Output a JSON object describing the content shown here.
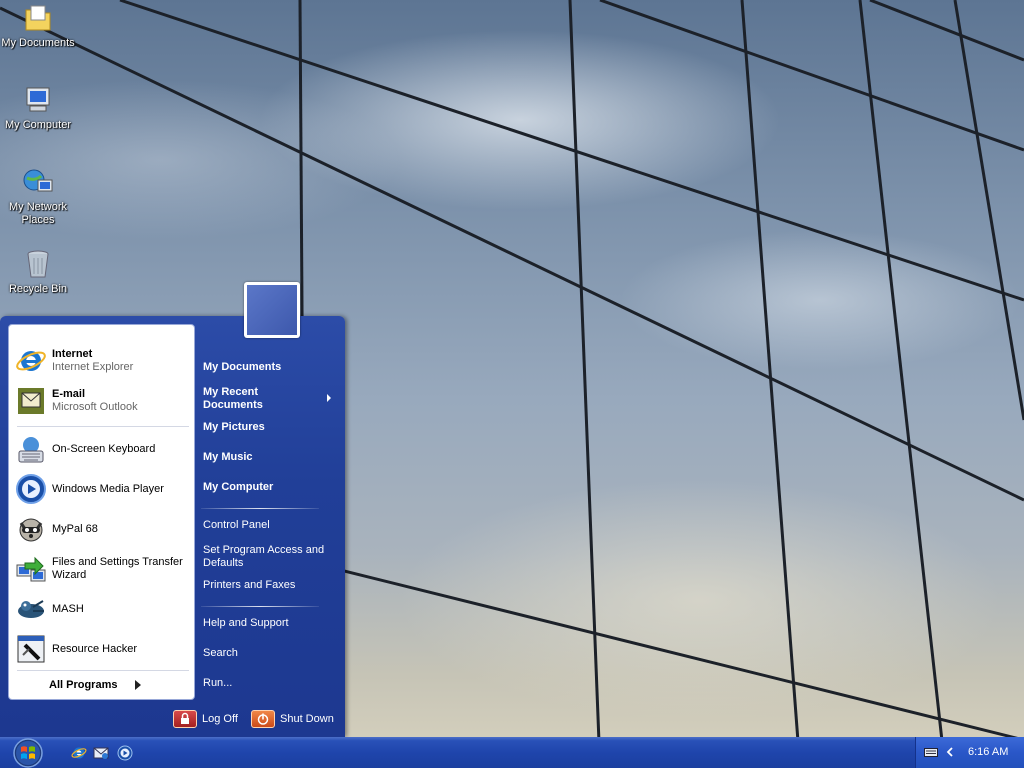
{
  "desktop": {
    "icons": [
      {
        "label": "My Documents",
        "icon": "folder-icon"
      },
      {
        "label": "My Computer",
        "icon": "computer-icon"
      },
      {
        "label": "My Network Places",
        "icon": "network-icon"
      },
      {
        "label": "Recycle Bin",
        "icon": "recycle-bin-icon"
      }
    ]
  },
  "start_menu": {
    "pinned": [
      {
        "title": "Internet",
        "subtitle": "Internet Explorer",
        "icon": "internet-explorer-icon"
      },
      {
        "title": "E-mail",
        "subtitle": "Microsoft Outlook",
        "icon": "outlook-icon"
      }
    ],
    "recent": [
      {
        "label": "On-Screen Keyboard",
        "icon": "keyboard-icon"
      },
      {
        "label": "Windows Media Player",
        "icon": "media-player-icon"
      },
      {
        "label": "MyPal 68",
        "icon": "mypal-icon"
      },
      {
        "label": "Files and Settings Transfer Wizard",
        "icon": "transfer-wizard-icon"
      },
      {
        "label": "MASH",
        "icon": "mash-icon"
      },
      {
        "label": "Resource Hacker",
        "icon": "resource-hacker-icon"
      }
    ],
    "all_programs": "All Programs",
    "places": [
      {
        "label": "My Documents"
      },
      {
        "label": "My Recent Documents"
      },
      {
        "label": "My Pictures"
      },
      {
        "label": "My Music"
      },
      {
        "label": "My Computer"
      }
    ],
    "system": [
      {
        "label": "Control Panel"
      },
      {
        "label": "Set Program Access and Defaults"
      },
      {
        "label": "Printers and Faxes"
      }
    ],
    "help": [
      {
        "label": "Help and Support"
      },
      {
        "label": "Search"
      },
      {
        "label": "Run..."
      }
    ],
    "log_off": "Log Off",
    "shut_down": "Shut Down"
  },
  "taskbar": {
    "quick_launch": [
      "internet-explorer-icon",
      "outlook-express-icon",
      "media-player-icon"
    ],
    "clock": "6:16 AM"
  },
  "colors": {
    "start_menu_blue": "#213f98",
    "taskbar_blue": "#1f45ac",
    "power_orange": "#e0602a"
  }
}
